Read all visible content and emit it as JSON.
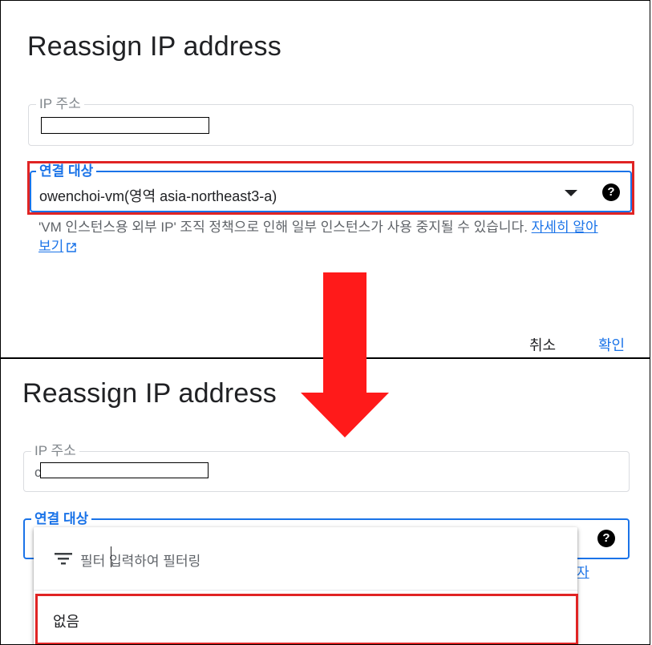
{
  "before": {
    "title": "Reassign IP address",
    "ip_field": {
      "label": "IP 주소",
      "value": ""
    },
    "target_field": {
      "label": "연결 대상",
      "value": "owenchoi-vm(영역 asia-northeast3-a)",
      "help": "?"
    },
    "hint": {
      "text": "'VM 인스턴스용 외부 IP' 조직 정책으로 인해 일부 인스턴스가 사용 중지될 수 있습니다.",
      "link": "자세히 알아보기"
    },
    "actions": {
      "cancel": "취소",
      "confirm": "확인"
    }
  },
  "after": {
    "title": "Reassign IP address",
    "ip_field": {
      "label": "IP 주소",
      "value": "c"
    },
    "target_field": {
      "label": "연결 대상",
      "help": "?"
    },
    "hint_link_fragment": "자",
    "dropdown": {
      "filter_prefix": "필터",
      "filter_placeholder": "입력하여 필터링",
      "options": [
        "없음"
      ]
    }
  },
  "colors": {
    "accent": "#1a73e8",
    "highlight": "#e02424",
    "arrow": "#ff1a1a",
    "text": "#202124",
    "muted": "#5f6368"
  },
  "icons": [
    "dropdown-caret-icon",
    "help-icon",
    "external-link-icon",
    "filter-icon",
    "down-arrow-icon"
  ]
}
